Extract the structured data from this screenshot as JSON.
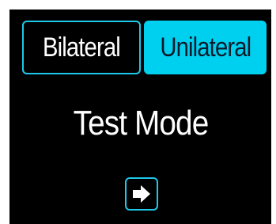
{
  "mode_selector": {
    "bilateral_label": "Bilateral",
    "unilateral_label": "Unilateral",
    "selected": "Unilateral"
  },
  "title": "Test Mode",
  "next_button": {
    "icon": "arrow-right-icon"
  },
  "colors": {
    "accent": "#00d0f0",
    "background": "#000000",
    "text": "#ffffff"
  }
}
